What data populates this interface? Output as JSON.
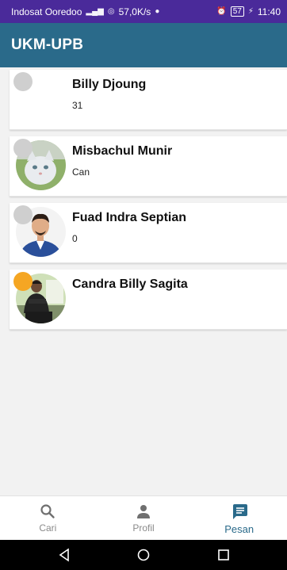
{
  "status_bar": {
    "carrier": "Indosat Ooredoo",
    "speed": "57,0K/s",
    "battery": "57",
    "time": "11:40"
  },
  "app_bar": {
    "title": "UKM-UPB"
  },
  "contacts": [
    {
      "name": "Billy Djoung",
      "message": "31",
      "online": false,
      "avatar": "blank-avatar"
    },
    {
      "name": "Misbachul Munir",
      "message": "Can",
      "online": false,
      "avatar": "cat-photo"
    },
    {
      "name": "Fuad Indra Septian",
      "message": "0",
      "online": false,
      "avatar": "man-blue-suit-photo"
    },
    {
      "name": "Candra Billy Sagita",
      "message": "",
      "online": true,
      "avatar": "man-green-room-photo"
    }
  ],
  "bottom_nav": {
    "items": [
      {
        "label": "Cari",
        "icon": "search-icon",
        "active": false
      },
      {
        "label": "Profil",
        "icon": "person-icon",
        "active": false
      },
      {
        "label": "Pesan",
        "icon": "message-icon",
        "active": true
      }
    ]
  },
  "colors": {
    "status_bar": "#4a2a9a",
    "app_bar": "#2a6a8a",
    "online_dot": "#f5a623",
    "offline_dot": "#cfcfcf",
    "active_nav": "#2a6a8a"
  }
}
